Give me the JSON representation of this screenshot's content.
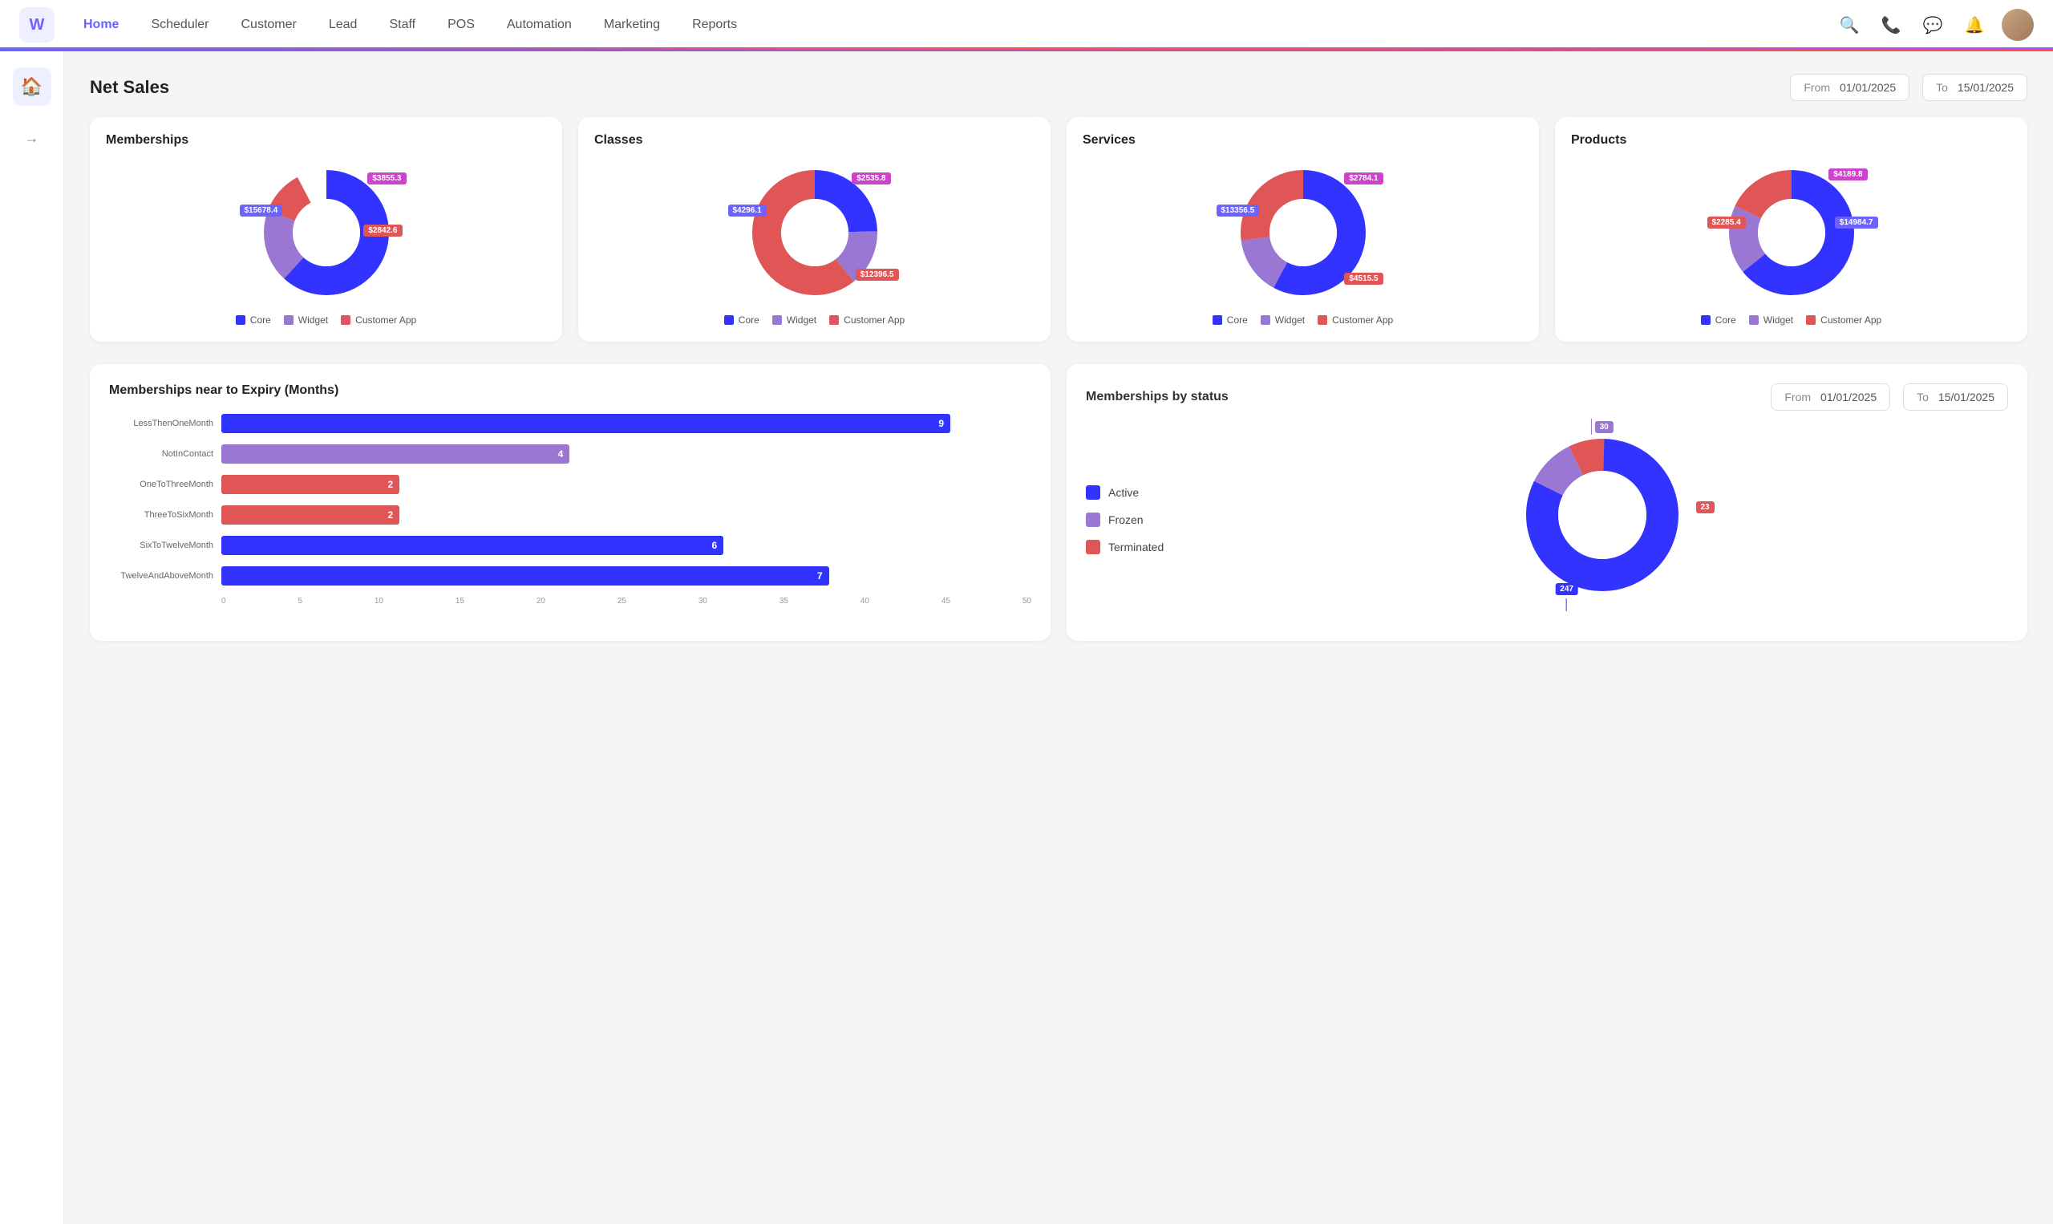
{
  "app": {
    "logo": "W"
  },
  "navbar": {
    "links": [
      {
        "label": "Home",
        "active": true
      },
      {
        "label": "Scheduler",
        "active": false
      },
      {
        "label": "Customer",
        "active": false
      },
      {
        "label": "Lead",
        "active": false
      },
      {
        "label": "Staff",
        "active": false
      },
      {
        "label": "POS",
        "active": false
      },
      {
        "label": "Automation",
        "active": false
      },
      {
        "label": "Marketing",
        "active": false
      },
      {
        "label": "Reports",
        "active": false
      }
    ]
  },
  "net_sales": {
    "title": "Net Sales",
    "from_label": "From",
    "from_value": "01/01/2025",
    "to_label": "To",
    "to_value": "15/01/2025"
  },
  "cards": [
    {
      "title": "Memberships",
      "segments": [
        {
          "label": "$15678.4",
          "color": "core",
          "value": 15678.4,
          "angle": 240
        },
        {
          "label": "$3855.3",
          "color": "widget",
          "value": 3855.3,
          "angle": 75
        },
        {
          "label": "$2842.6",
          "color": "app",
          "value": 2842.6,
          "angle": 45
        }
      ],
      "legend": [
        "Core",
        "Widget",
        "Customer App"
      ]
    },
    {
      "title": "Classes",
      "segments": [
        {
          "label": "$4296.1",
          "color": "core",
          "value": 4296.1
        },
        {
          "label": "$2535.8",
          "color": "widget",
          "value": 2535.8
        },
        {
          "label": "$12396.5",
          "color": "app",
          "value": 12396.5
        }
      ],
      "legend": [
        "Core",
        "Widget",
        "Customer App"
      ]
    },
    {
      "title": "Services",
      "segments": [
        {
          "label": "$13356.5",
          "color": "core",
          "value": 13356.5
        },
        {
          "label": "$2784.1",
          "color": "widget",
          "value": 2784.1
        },
        {
          "label": "$4515.5",
          "color": "app",
          "value": 4515.5
        }
      ],
      "legend": [
        "Core",
        "Widget",
        "Customer App"
      ]
    },
    {
      "title": "Products",
      "segments": [
        {
          "label": "$14984.7",
          "color": "core",
          "value": 14984.7
        },
        {
          "label": "$4189.8",
          "color": "widget",
          "value": 4189.8
        },
        {
          "label": "$2285.4",
          "color": "app",
          "value": 2285.4
        }
      ],
      "legend": [
        "Core",
        "Widget",
        "Customer App"
      ]
    }
  ],
  "expiry_chart": {
    "title": "Memberships near to Expiry (Months)",
    "bars": [
      {
        "label": "LessThenOneMonth",
        "value": 9,
        "color": "#3333ff",
        "pct": 90
      },
      {
        "label": "NotInContact",
        "value": 4,
        "color": "#9b77d4",
        "pct": 43
      },
      {
        "label": "OneToThreeMonth",
        "value": 2,
        "color": "#e05555",
        "pct": 22
      },
      {
        "label": "ThreeToSixMonth",
        "value": 2,
        "color": "#e05555",
        "pct": 22
      },
      {
        "label": "SixToTwelveMonth",
        "value": 6,
        "color": "#3333ff",
        "pct": 62
      },
      {
        "label": "TwelveAndAboveMonth",
        "value": 7,
        "color": "#3333ff",
        "pct": 75
      }
    ],
    "axis": [
      "0",
      "5",
      "10",
      "15",
      "20",
      "25",
      "30",
      "35",
      "40",
      "45",
      "50"
    ]
  },
  "status_chart": {
    "title": "Memberships by status",
    "from_label": "From",
    "from_value": "01/01/2025",
    "to_label": "To",
    "to_value": "15/01/2025",
    "statuses": [
      {
        "label": "Active",
        "color": "#3333ff"
      },
      {
        "label": "Frozen",
        "color": "#9b77d4"
      },
      {
        "label": "Terminated",
        "color": "#e05555"
      }
    ],
    "donut_labels": [
      {
        "value": "30",
        "position": "top"
      },
      {
        "value": "23",
        "position": "right"
      },
      {
        "value": "247",
        "position": "bottom"
      }
    ]
  }
}
